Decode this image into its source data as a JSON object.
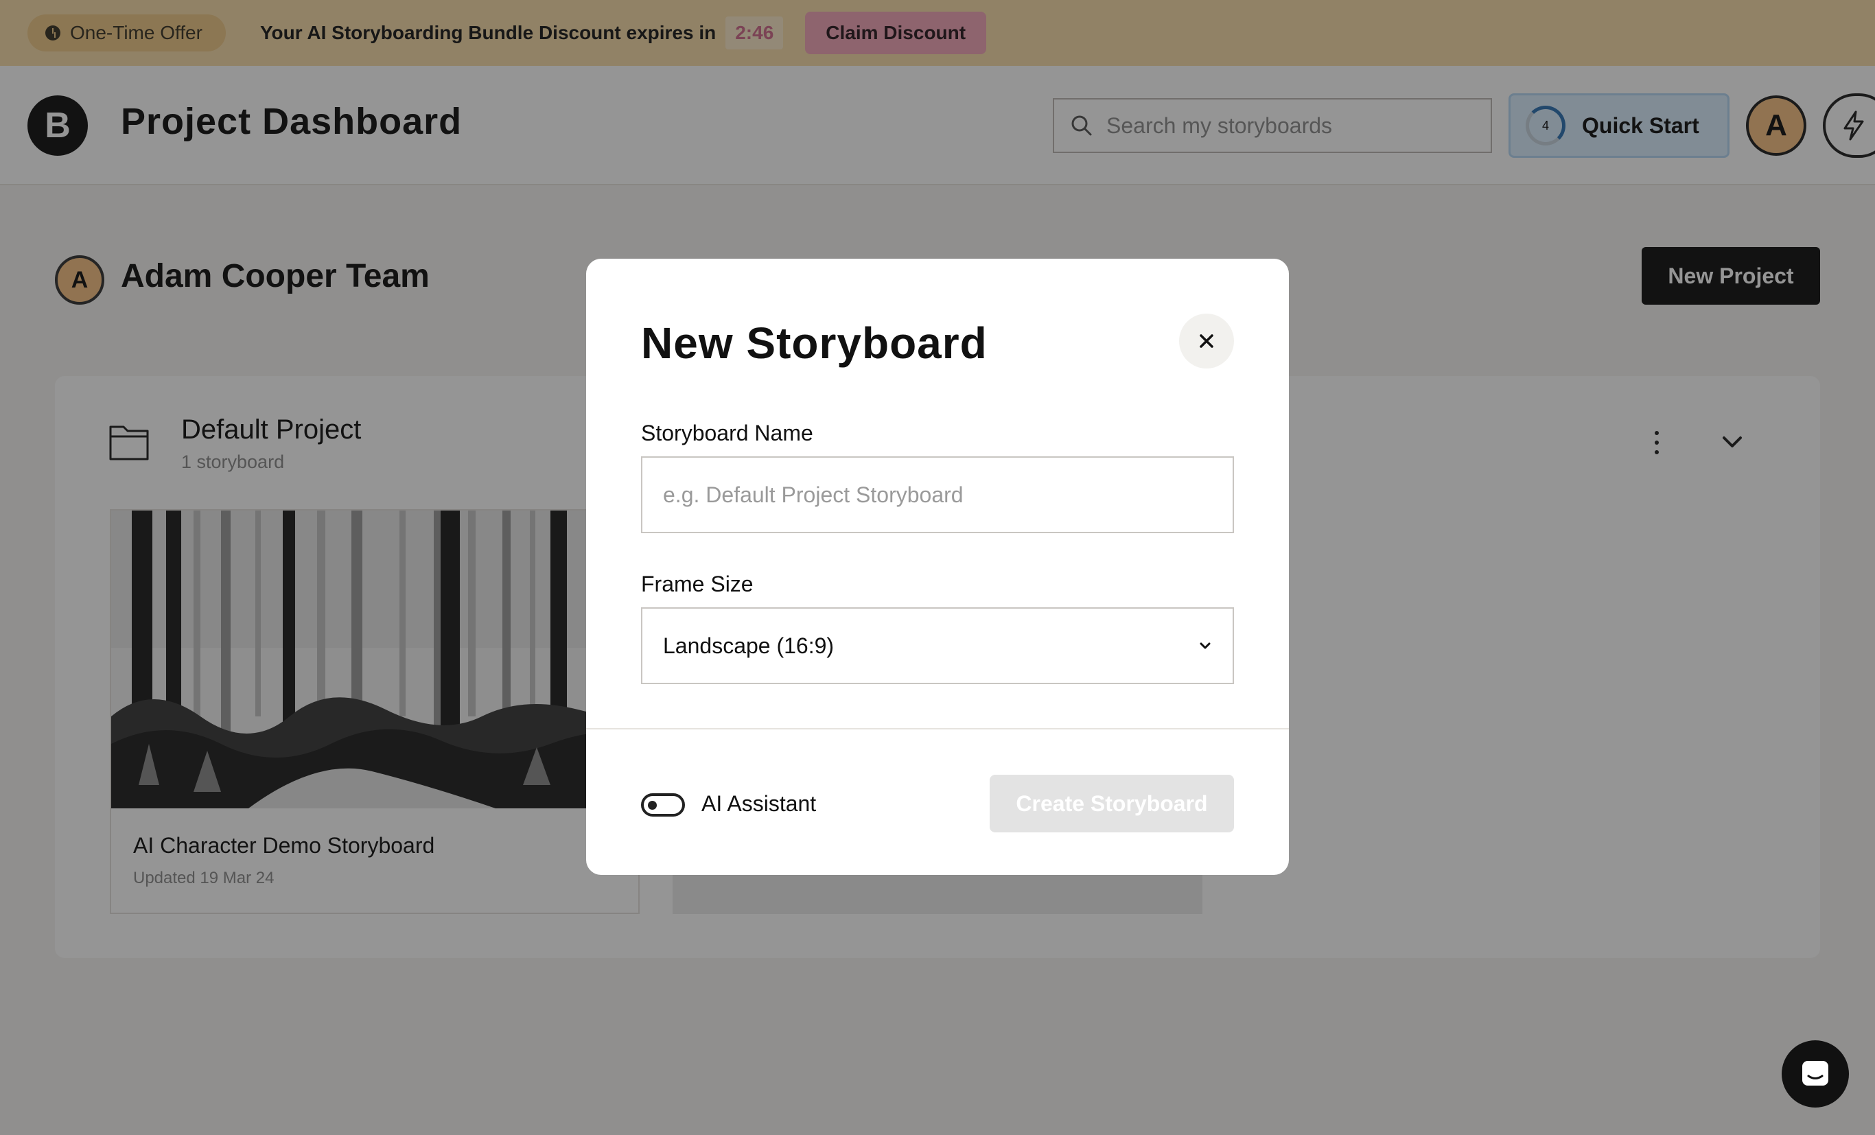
{
  "banner": {
    "offer_label": "One-Time Offer",
    "message": "Your AI Storyboarding Bundle Discount expires in",
    "timer": "2:46",
    "claim_label": "Claim Discount"
  },
  "header": {
    "logo_letter": "B",
    "title": "Project Dashboard",
    "search_placeholder": "Search my storyboards",
    "quick_start_label": "Quick Start",
    "quick_start_count": "4",
    "avatar_letter": "A"
  },
  "team": {
    "avatar_letter": "A",
    "name": "Adam Cooper Team",
    "new_project_label": "New Project"
  },
  "project": {
    "name": "Default Project",
    "count": "1 storyboard",
    "storyboards": [
      {
        "title": "AI Character Demo Storyboard",
        "updated": "Updated 19 Mar 24"
      }
    ]
  },
  "modal": {
    "title": "New Storyboard",
    "name_label": "Storyboard Name",
    "name_placeholder": "e.g. Default Project Storyboard",
    "name_value": "",
    "frame_label": "Frame Size",
    "frame_selected": "Landscape (16:9)",
    "ai_label": "AI Assistant",
    "ai_enabled": false,
    "create_label": "Create Storyboard"
  },
  "icons": {
    "offer": "clock-icon",
    "search": "search-icon",
    "quick_start": "progress-ring-icon",
    "bolt": "bolt-icon",
    "folder": "folder-icon",
    "more": "kebab-menu-icon",
    "collapse": "chevron-down-icon",
    "close": "close-icon",
    "select": "chevron-down-icon",
    "chat": "chat-icon"
  },
  "colors": {
    "banner_bg": "#f7dca9",
    "claim_bg": "#f2a6b8",
    "quick_start_bg": "#dbeeff",
    "primary_button": "#111111",
    "disabled_button": "#e3e3e3"
  }
}
